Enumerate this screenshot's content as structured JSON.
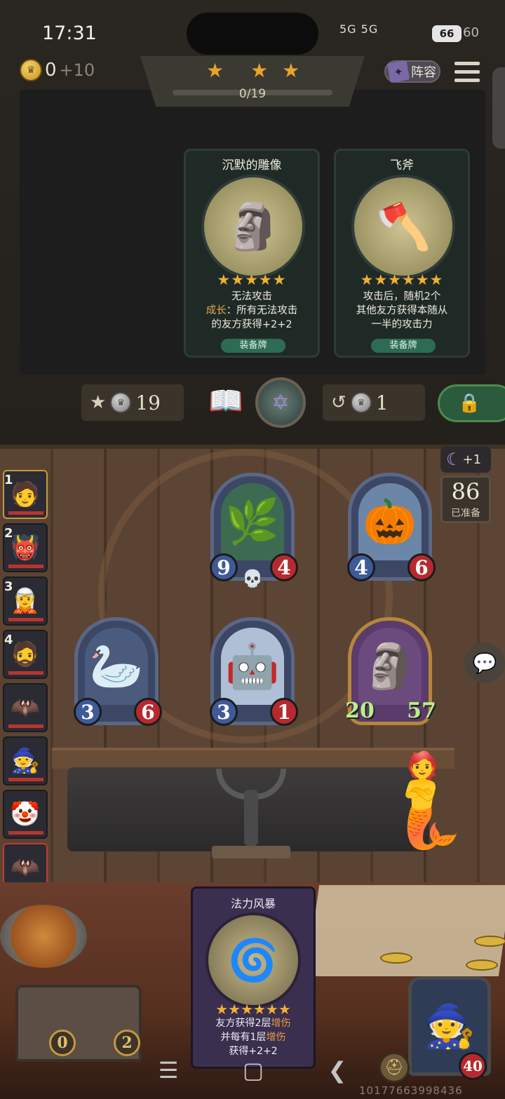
{
  "status_bar": {
    "time": "17:31",
    "network": "5G 5G",
    "battery": "66",
    "battery_ext": "60"
  },
  "top": {
    "gold": "0",
    "gold_income": "+10",
    "tier_stars": [
      "★",
      "★",
      "★"
    ],
    "tier_progress": "0/19",
    "lineup_label": "阵容"
  },
  "shop_cards": [
    {
      "title": "沉默的雕像",
      "art_icon": "statue-icon",
      "art_glyph": "🗿",
      "stars": "★★★★★",
      "desc_line1": "无法攻击",
      "desc_highlight": "成长",
      "desc_line2": "：所有无法攻击",
      "desc_line3": "的友方获得+2+2",
      "tag": "装备牌"
    },
    {
      "title": "飞斧",
      "art_icon": "axe-icon",
      "art_glyph": "🪓",
      "stars": "★★★★★★",
      "desc_line1": "攻击后，随机2个",
      "desc_line2": "其他友方获得本随从",
      "desc_line3": "一半的攻击力",
      "tag": "装备牌"
    }
  ],
  "shop_bar": {
    "upgrade_cost": "19",
    "refresh_cost": "1"
  },
  "board_side": {
    "moon_bonus": "+1",
    "ready_count": "86",
    "ready_label": "已准备"
  },
  "roster": [
    {
      "num": "1",
      "glyph": "🧑"
    },
    {
      "num": "2",
      "glyph": "👹"
    },
    {
      "num": "3",
      "glyph": "🧝"
    },
    {
      "num": "4",
      "glyph": "🧔"
    },
    {
      "num": "",
      "glyph": "🦇"
    },
    {
      "num": "",
      "glyph": "🧙"
    },
    {
      "num": "",
      "glyph": "🤡"
    },
    {
      "num": "",
      "glyph": "🦇"
    }
  ],
  "units": [
    {
      "name": "plant-creature",
      "glyph": "🌿",
      "atk": "9",
      "hp": "4"
    },
    {
      "name": "pumpkin-ghost",
      "glyph": "🎃",
      "atk": "4",
      "hp": "6"
    },
    {
      "name": "goose",
      "glyph": "🦢",
      "atk": "3",
      "hp": "6"
    },
    {
      "name": "robot",
      "glyph": "🤖",
      "atk": "3",
      "hp": "1"
    },
    {
      "name": "tiki-mask",
      "glyph": "🗿",
      "atk": "20",
      "hp": "57"
    }
  ],
  "spell_card": {
    "title": "法力风暴",
    "art_glyph": "🌀",
    "stars": "★★★★★★",
    "desc_pre": "友方获得2层",
    "desc_hl1": "增伤",
    "desc_mid": "并每有1层",
    "desc_hl2": "增伤",
    "desc_end": "获得+2+2"
  },
  "chests": {
    "left": "0",
    "right": "2"
  },
  "hero": {
    "glyph": "🧙",
    "hp": "40"
  },
  "nav": {
    "menu": "☰",
    "home": "▢",
    "back": "❮"
  },
  "footer_id": "10177663998436",
  "colors": {
    "gold": "#f0b032",
    "attack_blue": "#3f5a98",
    "health_red": "#b52a2e",
    "tag_green": "#2d6b54",
    "highlight_orange": "#e3a94a"
  }
}
